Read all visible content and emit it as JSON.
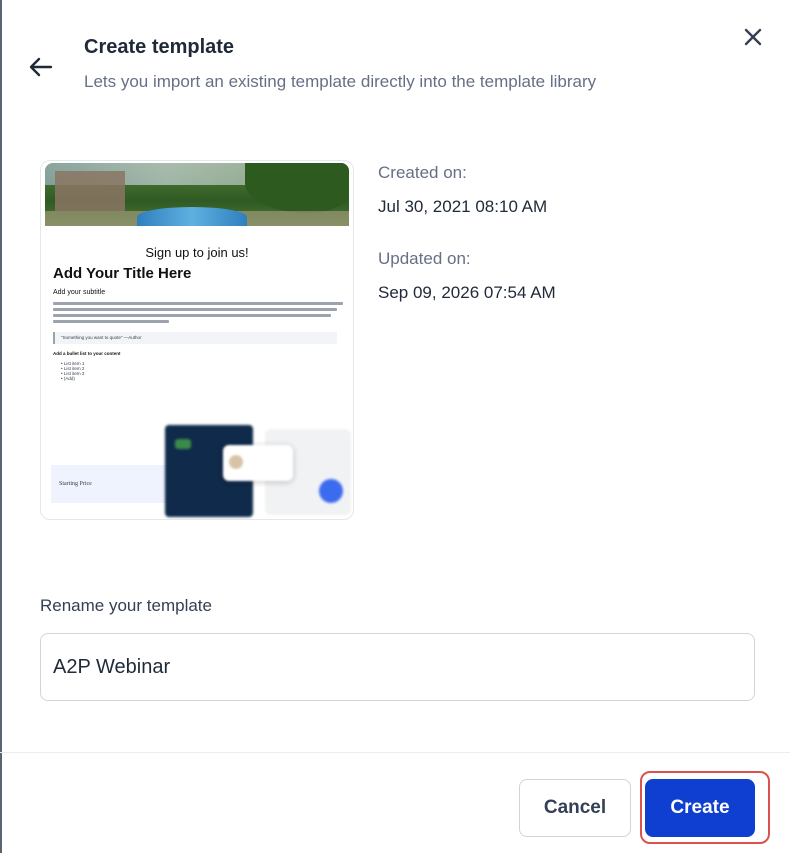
{
  "header": {
    "title": "Create template",
    "subtitle": "Lets you import an existing template directly into the template library"
  },
  "icons": {
    "back": "arrow-left-icon",
    "close": "close-icon"
  },
  "preview": {
    "signup_text": "Sign up to join us!",
    "heading": "Add Your Title Here",
    "subheading": "Add your subtitle",
    "quote": "\"Something you want to quote\" —Author",
    "bullets_title": "Add a bullet list to your content",
    "bullets": [
      "List item 1",
      "List item 2",
      "List item 3",
      "(Add)"
    ],
    "price_label": "Starting Price"
  },
  "meta": {
    "created_label": "Created on:",
    "created_value": "Jul 30, 2021 08:10 AM",
    "updated_label": "Updated on:",
    "updated_value": "Sep 09, 2026 07:54 AM"
  },
  "rename": {
    "label": "Rename your template",
    "value": "A2P Webinar"
  },
  "footer": {
    "cancel_label": "Cancel",
    "create_label": "Create"
  },
  "colors": {
    "primary": "#0e3fd0",
    "highlight_outline": "#d9534f",
    "muted_text": "#667085"
  }
}
